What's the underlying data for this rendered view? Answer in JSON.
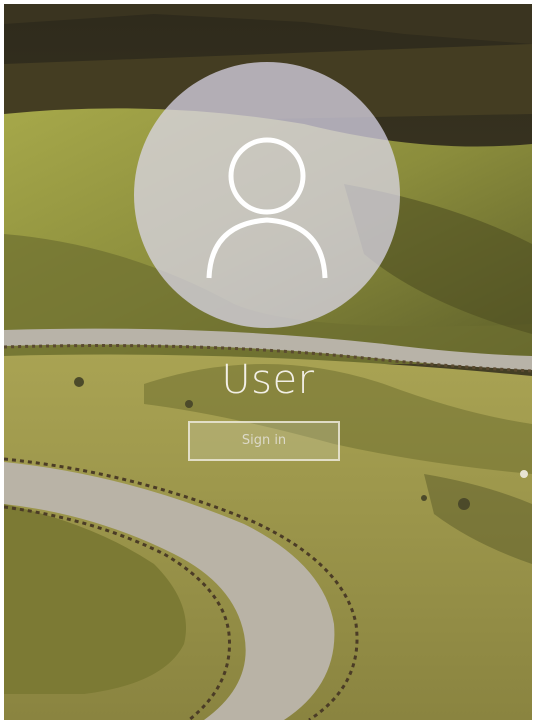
{
  "lock_screen": {
    "user_name": "User",
    "sign_in_label": "Sign in"
  },
  "avatar": {
    "icon": "user-silhouette-icon"
  },
  "colors": {
    "avatar_circle": "#dedaee",
    "text": "#f2efe6",
    "button_border": "#ebe8d7"
  }
}
